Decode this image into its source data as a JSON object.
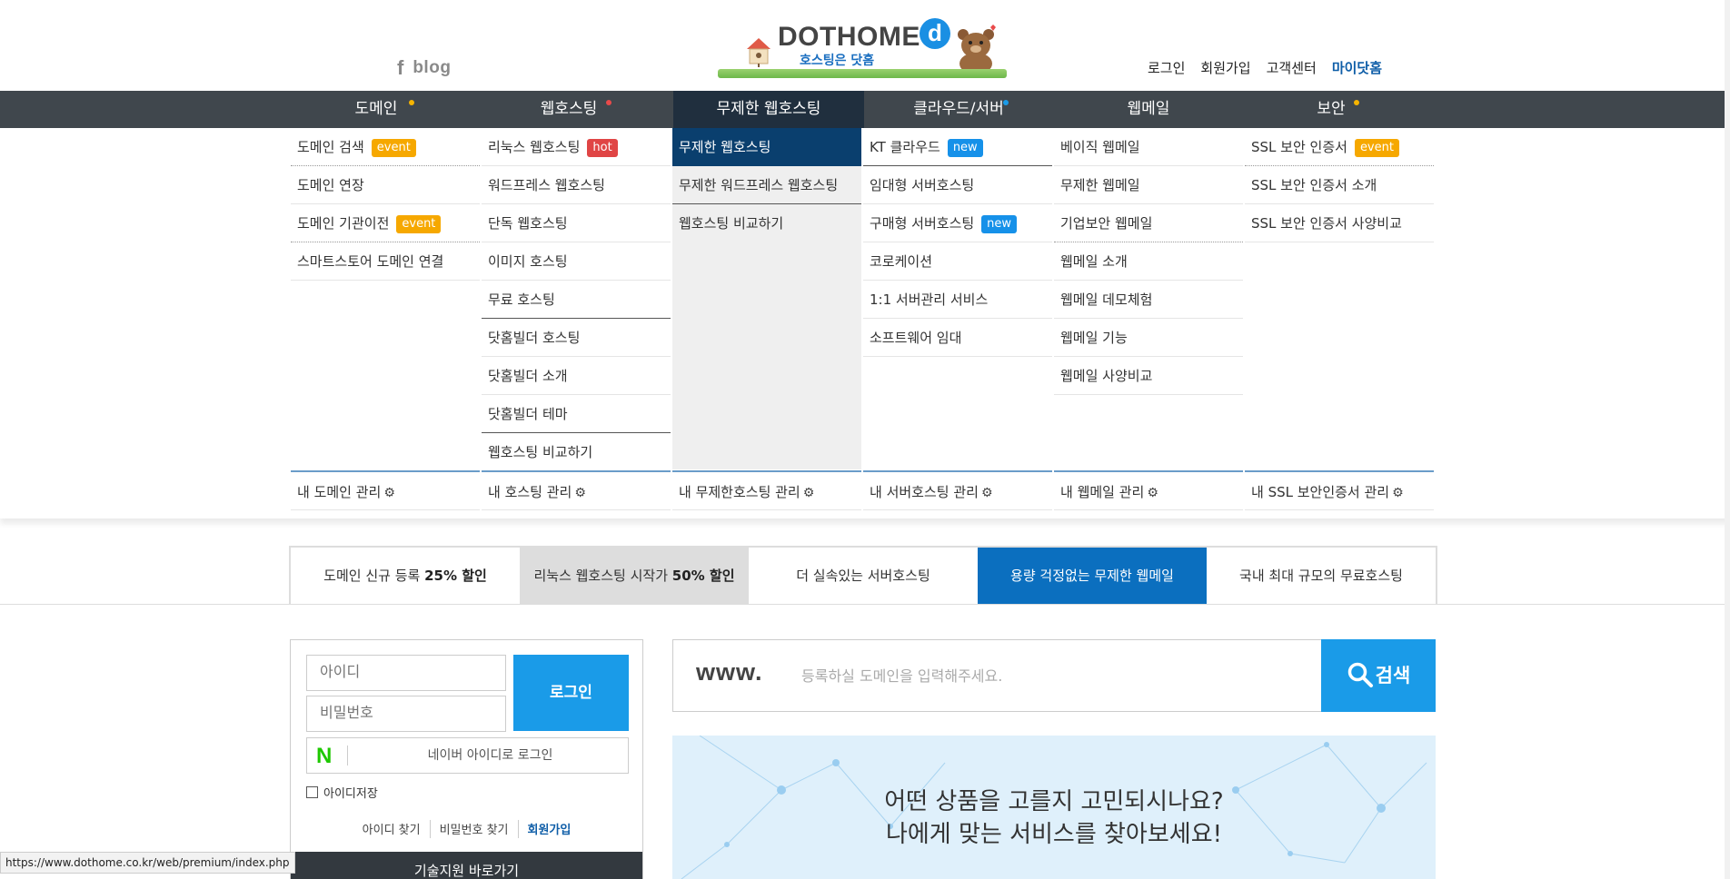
{
  "header": {
    "social_fb": "f",
    "social_blog": "blog",
    "logo_brand": "DOTHOME",
    "logo_d": "d",
    "logo_tagline": "호스팅은 닷홈",
    "util": [
      "로그인",
      "회원가입",
      "고객센터",
      "마이닷홈"
    ]
  },
  "gnb": [
    {
      "label": "도메인",
      "dot": "#f6b400"
    },
    {
      "label": "웹호스팅",
      "dot": "#e94a4a"
    },
    {
      "label": "무제한 웹호스팅",
      "dot": ""
    },
    {
      "label": "클라우드/서버",
      "dot": "#1a9be8"
    },
    {
      "label": "웹메일",
      "dot": ""
    },
    {
      "label": "보안",
      "dot": "#f6b400"
    }
  ],
  "menu": {
    "domain": [
      {
        "label": "도메인 검색",
        "badge": "event"
      },
      {
        "label": "도메인 연장",
        "badge": ""
      },
      {
        "label": "도메인 기관이전",
        "badge": "event"
      },
      {
        "label": "스마트스토어 도메인 연결",
        "badge": ""
      }
    ],
    "hosting": [
      {
        "label": "리눅스 웹호스팅",
        "badge": "hot"
      },
      {
        "label": "워드프레스 웹호스팅",
        "badge": ""
      },
      {
        "label": "단독 웹호스팅",
        "badge": ""
      },
      {
        "label": "이미지 호스팅",
        "badge": ""
      },
      {
        "label": "무료 호스팅",
        "badge": ""
      },
      {
        "label": "닷홈빌더 호스팅",
        "badge": ""
      },
      {
        "label": "닷홈빌더 소개",
        "badge": ""
      },
      {
        "label": "닷홈빌더 테마",
        "badge": ""
      },
      {
        "label": "웹호스팅 비교하기",
        "badge": ""
      }
    ],
    "unlimited": [
      {
        "label": "무제한 웹호스팅",
        "badge": ""
      },
      {
        "label": "무제한 워드프레스 웹호스팅",
        "badge": ""
      },
      {
        "label": "웹호스팅 비교하기",
        "badge": ""
      }
    ],
    "cloud": [
      {
        "label": "KT 클라우드",
        "badge": "new"
      },
      {
        "label": "임대형 서버호스팅",
        "badge": ""
      },
      {
        "label": "구매형 서버호스팅",
        "badge": "new"
      },
      {
        "label": "코로케이션",
        "badge": ""
      },
      {
        "label": "1:1 서버관리 서비스",
        "badge": ""
      },
      {
        "label": "소프트웨어 임대",
        "badge": ""
      }
    ],
    "webmail": [
      {
        "label": "베이직 웹메일",
        "badge": ""
      },
      {
        "label": "무제한 웹메일",
        "badge": ""
      },
      {
        "label": "기업보안 웹메일",
        "badge": ""
      },
      {
        "label": "웹메일 소개",
        "badge": ""
      },
      {
        "label": "웹메일 데모체험",
        "badge": ""
      },
      {
        "label": "웹메일 기능",
        "badge": ""
      },
      {
        "label": "웹메일 사양비교",
        "badge": ""
      }
    ],
    "security": [
      {
        "label": "SSL 보안 인증서",
        "badge": "event"
      },
      {
        "label": "SSL 보안 인증서 소개",
        "badge": ""
      },
      {
        "label": "SSL 보안 인증서 사양비교",
        "badge": ""
      }
    ],
    "manage": [
      "내 도메인 관리",
      "내 호스팅 관리",
      "내 무제한호스팅 관리",
      "내 서버호스팅 관리",
      "내 웹메일 관리",
      "내 SSL 보안인증서 관리"
    ]
  },
  "promo": [
    {
      "pre": "도메인 신규 등록 ",
      "bold": "25% 할인"
    },
    {
      "pre": "리눅스 웹호스팅 시작가 ",
      "bold": "50% 할인"
    },
    {
      "pre": "더 실속있는 서버호스팅",
      "bold": ""
    },
    {
      "pre": "용량 걱정없는 무제한 웹메일",
      "bold": ""
    },
    {
      "pre": "국내 최대 규모의 무료호스팅",
      "bold": ""
    }
  ],
  "login": {
    "id_placeholder": "아이디",
    "pw_placeholder": "비밀번호",
    "button": "로그인",
    "naver_n": "N",
    "naver_label": "네이버 아이디로 로그인",
    "save_id": "아이디저장",
    "find_id": "아이디 찾기",
    "find_pw": "비밀번호 찾기",
    "join": "회원가입",
    "bottom_banner": "기술지원 바로가기"
  },
  "domain_search": {
    "prefix": "www.",
    "placeholder": "등록하실 도메인을 입력해주세요.",
    "button": "검색"
  },
  "banner": {
    "line1": "어떤 상품을 고를지 고민되시나요?",
    "line2": "나에게 맞는 서비스를 찾아보세요!"
  },
  "status_url": "https://www.dothome.co.kr/web/premium/index.php"
}
